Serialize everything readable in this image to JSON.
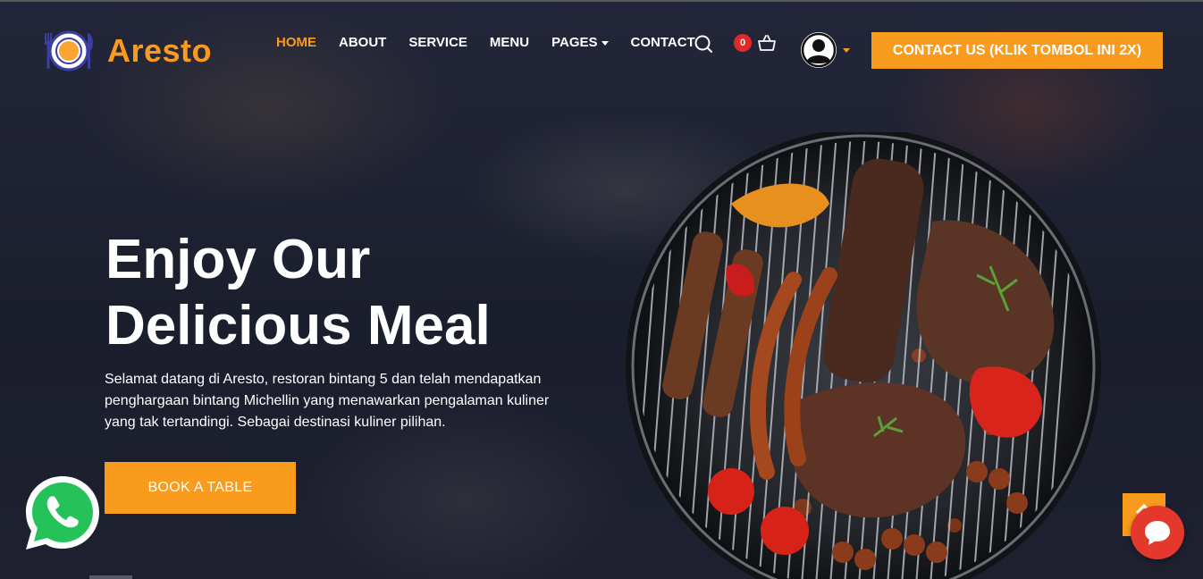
{
  "brand": {
    "name": "Aresto",
    "accent_color": "#f99b1d",
    "logo_icon": "plate-cutlery-icon"
  },
  "nav": {
    "items": [
      {
        "label": "HOME",
        "active": true
      },
      {
        "label": "ABOUT",
        "active": false
      },
      {
        "label": "SERVICE",
        "active": false
      },
      {
        "label": "MENU",
        "active": false
      },
      {
        "label": "PAGES",
        "active": false,
        "dropdown": true
      },
      {
        "label": "CONTACT",
        "active": false
      }
    ]
  },
  "header": {
    "search_icon": "search-icon",
    "cart_count": "0",
    "cart_icon": "shopping-basket-icon",
    "user_icon": "user-avatar-icon",
    "cta_label": "CONTACT US (KLIK TOMBOL INI 2X)"
  },
  "hero": {
    "title_line1": "Enjoy Our",
    "title_line2": "Delicious Meal",
    "description": "Selamat datang di Aresto, restoran bintang 5 dan telah mendapatkan penghargaan bintang Michellin yang menawarkan pengalaman kuliner yang tak tertandingi. Sebagai destinasi kuliner pilihan.",
    "book_label": "BOOK A TABLE"
  },
  "widgets": {
    "whatsapp_icon": "whatsapp-icon",
    "back_to_top_icon": "arrow-up-icon",
    "chat_icon": "chat-bubble-icon",
    "chat_color": "#e5382c"
  }
}
